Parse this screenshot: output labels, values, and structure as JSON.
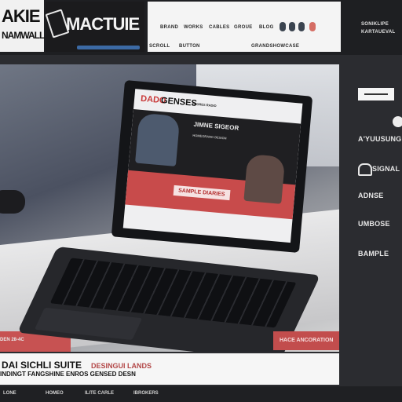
{
  "header": {
    "logo_left_line1": "AKIE",
    "logo_left_line2": "NAMWALL",
    "brand": "MACTUIE",
    "nav": [
      "BRAND",
      "WORKS",
      "CABLES",
      "GROUE",
      "BLOG",
      "SCROLL",
      "BUTTON",
      "GRANDSHOWCASE"
    ],
    "menu_right": [
      "SONIKLIPE",
      "KARTAUEVAL"
    ],
    "colors": {
      "accent": "#d56d64",
      "dark": "#1e1f22",
      "blue": "#3c6aa4"
    }
  },
  "hero": {
    "screen": {
      "logo": "DADO",
      "brand": "GENSES",
      "nav": "PRORES RADIO",
      "heading": "JIMNE SIGEOR",
      "subheading": "HOMEGRANG DESIGN",
      "cta": "SAMPLE DIARIES"
    },
    "caption": "DEN 28-4C",
    "cta_button": "HACE ANCORATION"
  },
  "sidebar": {
    "items": [
      "A'YUUSUNG",
      "SIGNAL",
      "ADNSE",
      "UMBOSE",
      "BAMPLE"
    ]
  },
  "footer": {
    "title": "DAI SICHLI SUITE",
    "subtitle": "DESINGUI LANDS",
    "line": "INDINGT FANGSHINE ENROS GENSED DESN"
  },
  "bottom_bar": {
    "items": [
      "LONE",
      "HOMEO",
      "ILITE CARLE",
      "IBROKERS"
    ]
  }
}
